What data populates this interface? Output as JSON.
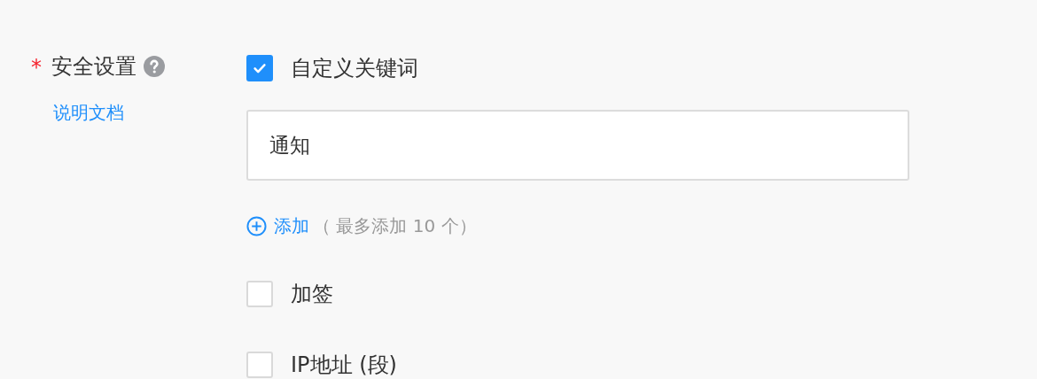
{
  "field": {
    "required": true,
    "required_mark": "*",
    "label": "安全设置",
    "help_link": "说明文档",
    "options": [
      {
        "kind": "keywords",
        "label": "自定义关键词",
        "checked": true,
        "keywords": [
          "通知"
        ],
        "add_label": "添加",
        "add_hint": "（ 最多添加 10 个）"
      },
      {
        "kind": "checkbox",
        "label": "加签",
        "checked": false
      },
      {
        "kind": "checkbox",
        "label": "IP地址 (段)",
        "checked": false
      }
    ]
  }
}
